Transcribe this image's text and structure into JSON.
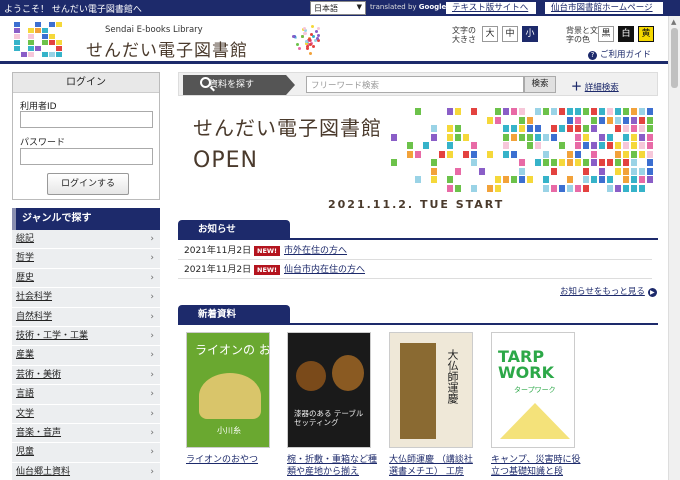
{
  "topbar": {
    "welcome": "ようこそ！ せんだい電子図書館へ",
    "language": "日本語",
    "translated_by": "translated by",
    "google": "Google",
    "text_site_link": "テキスト版サイトへ",
    "library_home_link": "仙台市図書館ホームページ"
  },
  "header": {
    "logo_sub": "Sendai E-books Library",
    "logo_title": "せんだい電子図書館",
    "font_size_label": "文字の大きさ",
    "font_sizes": [
      "大",
      "中",
      "小"
    ],
    "font_size_selected": "小",
    "color_label": "背景と文字の色",
    "colors": [
      "黒",
      "白",
      "黄"
    ],
    "guide": "ご利用ガイド"
  },
  "login": {
    "title": "ログイン",
    "user_id_label": "利用者ID",
    "password_label": "パスワード",
    "button": "ログインする"
  },
  "genre": {
    "title": "ジャンルで探す",
    "items": [
      "総記",
      "哲学",
      "歴史",
      "社会科学",
      "自然科学",
      "技術・工学・工業",
      "産業",
      "芸術・美術",
      "言語",
      "文学",
      "音楽・音声",
      "児童",
      "仙台郷土資料"
    ]
  },
  "search": {
    "label": "資料を探す",
    "placeholder": "フリーワード検索",
    "button": "検索",
    "advanced": "詳細検索"
  },
  "banner": {
    "title": "せんだい電子図書館",
    "open": "OPEN",
    "date": "2021.11.2. TUE  START"
  },
  "news": {
    "title": "お知らせ",
    "items": [
      {
        "date": "2021年11月2日",
        "badge": "NEW!",
        "text": "市外在住の方へ"
      },
      {
        "date": "2021年11月2日",
        "badge": "NEW!",
        "text": "仙台市内在住の方へ"
      }
    ],
    "more": "お知らせをもっと見る"
  },
  "new_books": {
    "title": "新着資料",
    "items": [
      {
        "title": "ライオンのおやつ",
        "cover_text": "ライオンの おやつ",
        "author": "小川糸"
      },
      {
        "title": "椀・折敷・重箱など種類や産地から揃え",
        "cover_text": "漆器のある テーブルセッティング"
      },
      {
        "title": "大仏師運慶 （講談社選書メチエ） 工房",
        "cover_text": "大仏師運慶"
      },
      {
        "title": "キャンプ、災害時に役立つ基礎知識と段",
        "cover_text": "TARP WORK",
        "cover_sub": "タープワーク"
      }
    ]
  },
  "colors": {
    "navy": "#1d2a6b",
    "new_badge": "#b4141e",
    "title_brown": "#4a3a2c"
  }
}
